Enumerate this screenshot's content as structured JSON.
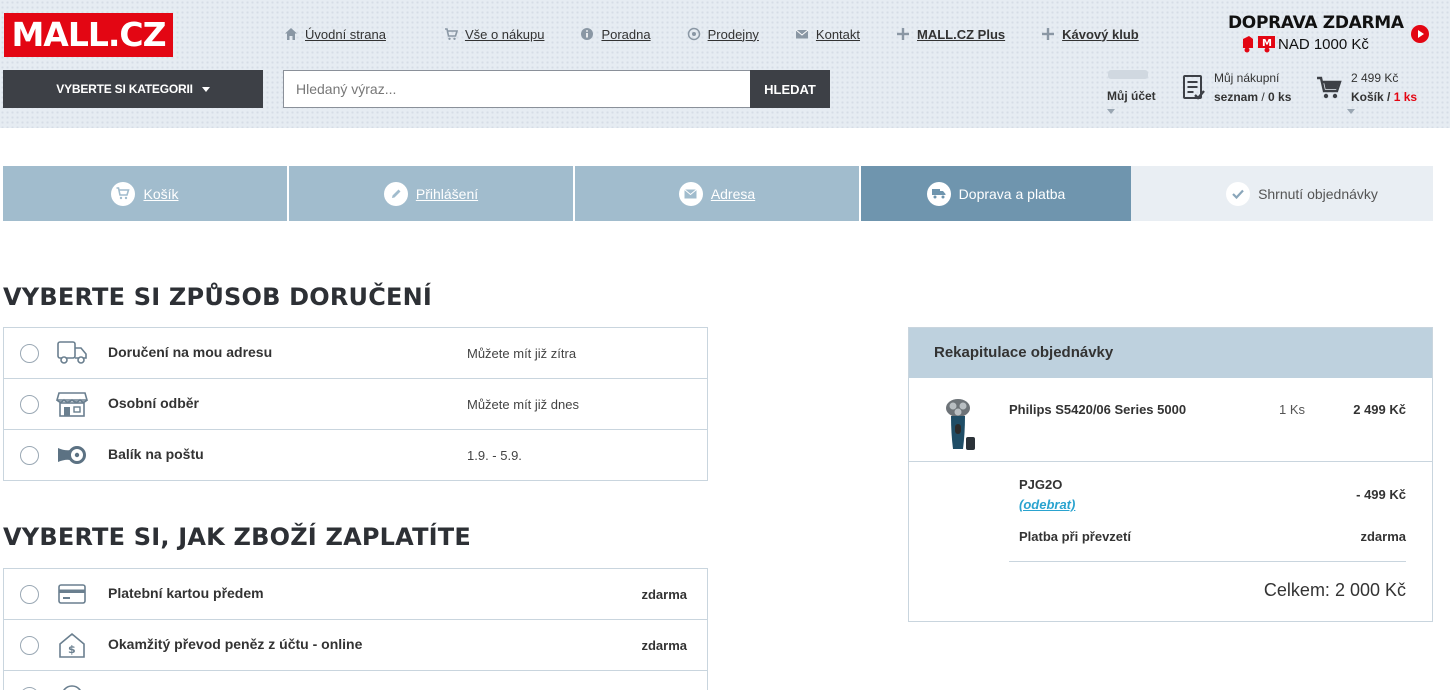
{
  "header": {
    "logo": "MALL.CZ",
    "nav": [
      {
        "label": "Úvodní strana",
        "icon": "home-icon"
      },
      {
        "label": "Vše o nákupu",
        "icon": "cart-icon"
      },
      {
        "label": "Poradna",
        "icon": "info-icon"
      },
      {
        "label": "Prodejny",
        "icon": "store-icon"
      },
      {
        "label": "Kontakt",
        "icon": "mail-icon"
      },
      {
        "label": "MALL.CZ Plus",
        "icon": "plus-icon"
      },
      {
        "label": "Kávový klub",
        "icon": "plus-icon"
      }
    ],
    "free_shipping_title": "DOPRAVA ZDARMA",
    "free_shipping_sub": "NAD 1000 Kč",
    "category_button": "VYBERTE SI KATEGORII",
    "search_placeholder": "Hledaný výraz...",
    "search_button": "HLEDAT",
    "account_label": "Můj účet",
    "wishlist_line1": "Můj nákupní",
    "wishlist_line2": "seznam",
    "wishlist_count": "0 ks",
    "cart_price": "2 499 Kč",
    "cart_label": "Košík",
    "cart_count": "1 ks"
  },
  "steps": [
    {
      "label": "Košík",
      "icon": "cart-icon"
    },
    {
      "label": "Přihlášení",
      "icon": "pencil-icon"
    },
    {
      "label": "Adresa",
      "icon": "mail-icon"
    },
    {
      "label": "Doprava a platba",
      "icon": "truck-icon"
    },
    {
      "label": "Shrnutí objednávky",
      "icon": "check-icon"
    }
  ],
  "delivery": {
    "title": "VYBERTE SI ZPŮSOB DORUČENÍ",
    "options": [
      {
        "name": "Doručení na mou adresu",
        "info": "Můžete mít již zítra",
        "icon": "truck-icon"
      },
      {
        "name": "Osobní odběr",
        "info": "Můžete mít již dnes",
        "icon": "store-icon"
      },
      {
        "name": "Balík na poštu",
        "info": "1.9. - 5.9.",
        "icon": "post-horn-icon"
      }
    ]
  },
  "payment": {
    "title": "VYBERTE SI, JAK ZBOŽÍ ZAPLATÍTE",
    "options": [
      {
        "name": "Platební kartou předem",
        "price": "zdarma",
        "icon": "credit-card-icon"
      },
      {
        "name": "Okamžitý převod peněz z účtu - online",
        "price": "zdarma",
        "icon": "bank-transfer-icon"
      }
    ]
  },
  "summary": {
    "title": "Rekapitulace objednávky",
    "product_name": "Philips S5420/06 Series 5000",
    "product_qty": "1 Ks",
    "product_price": "2 499 Kč",
    "coupon_code": "PJG2O",
    "coupon_remove": "(odebrat)",
    "coupon_discount": "- 499 Kč",
    "payment_method": "Platba při převzetí",
    "payment_method_price": "zdarma",
    "total": "Celkem: 2 000 Kč"
  },
  "colors": {
    "brand_red": "#e30613",
    "step_done": "#a1bccd",
    "step_active": "#6f95ae",
    "step_todo": "#e9eef3",
    "summary_header": "#bed1de",
    "link_blue": "#2aa3cf"
  }
}
